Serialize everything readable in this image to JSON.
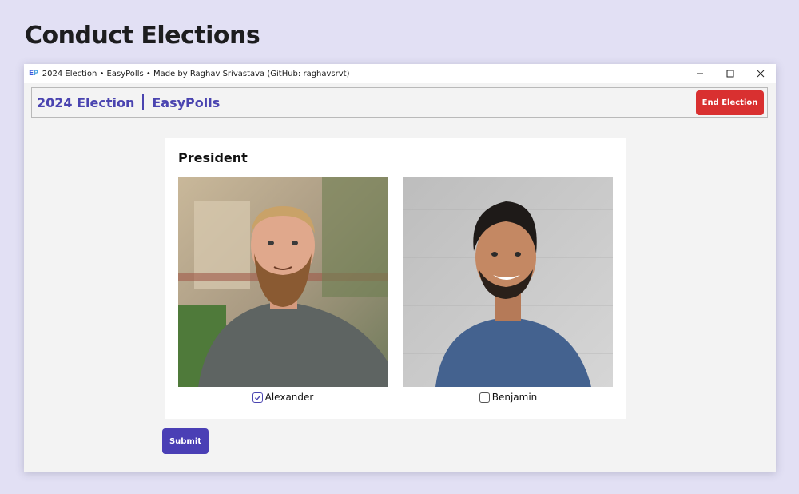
{
  "page": {
    "heading": "Conduct Elections"
  },
  "window": {
    "title": "2024 Election • EasyPolls • Made by Raghav Srivastava (GitHub: raghavsrvt)",
    "app_icon_text": "EP",
    "controls": [
      "minimize-icon",
      "maximize-icon",
      "close-icon"
    ]
  },
  "navbar": {
    "election_name": "2024 Election",
    "app_name": "EasyPolls",
    "end_button_label": "End Election"
  },
  "ballot": {
    "position": "President",
    "candidates": [
      {
        "name": "Alexander",
        "selected": true
      },
      {
        "name": "Benjamin",
        "selected": false
      }
    ],
    "submit_label": "Submit"
  },
  "colors": {
    "accent": "#4a44b0",
    "danger": "#d93030",
    "background": "#e2e0f4"
  }
}
